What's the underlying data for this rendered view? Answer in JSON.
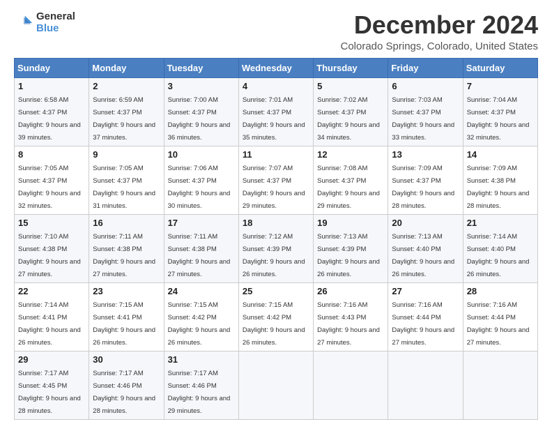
{
  "logo": {
    "general": "General",
    "blue": "Blue"
  },
  "title": "December 2024",
  "subtitle": "Colorado Springs, Colorado, United States",
  "days_header": [
    "Sunday",
    "Monday",
    "Tuesday",
    "Wednesday",
    "Thursday",
    "Friday",
    "Saturday"
  ],
  "weeks": [
    [
      {
        "day": "1",
        "sunrise": "Sunrise: 6:58 AM",
        "sunset": "Sunset: 4:37 PM",
        "daylight": "Daylight: 9 hours and 39 minutes."
      },
      {
        "day": "2",
        "sunrise": "Sunrise: 6:59 AM",
        "sunset": "Sunset: 4:37 PM",
        "daylight": "Daylight: 9 hours and 37 minutes."
      },
      {
        "day": "3",
        "sunrise": "Sunrise: 7:00 AM",
        "sunset": "Sunset: 4:37 PM",
        "daylight": "Daylight: 9 hours and 36 minutes."
      },
      {
        "day": "4",
        "sunrise": "Sunrise: 7:01 AM",
        "sunset": "Sunset: 4:37 PM",
        "daylight": "Daylight: 9 hours and 35 minutes."
      },
      {
        "day": "5",
        "sunrise": "Sunrise: 7:02 AM",
        "sunset": "Sunset: 4:37 PM",
        "daylight": "Daylight: 9 hours and 34 minutes."
      },
      {
        "day": "6",
        "sunrise": "Sunrise: 7:03 AM",
        "sunset": "Sunset: 4:37 PM",
        "daylight": "Daylight: 9 hours and 33 minutes."
      },
      {
        "day": "7",
        "sunrise": "Sunrise: 7:04 AM",
        "sunset": "Sunset: 4:37 PM",
        "daylight": "Daylight: 9 hours and 32 minutes."
      }
    ],
    [
      {
        "day": "8",
        "sunrise": "Sunrise: 7:05 AM",
        "sunset": "Sunset: 4:37 PM",
        "daylight": "Daylight: 9 hours and 32 minutes."
      },
      {
        "day": "9",
        "sunrise": "Sunrise: 7:05 AM",
        "sunset": "Sunset: 4:37 PM",
        "daylight": "Daylight: 9 hours and 31 minutes."
      },
      {
        "day": "10",
        "sunrise": "Sunrise: 7:06 AM",
        "sunset": "Sunset: 4:37 PM",
        "daylight": "Daylight: 9 hours and 30 minutes."
      },
      {
        "day": "11",
        "sunrise": "Sunrise: 7:07 AM",
        "sunset": "Sunset: 4:37 PM",
        "daylight": "Daylight: 9 hours and 29 minutes."
      },
      {
        "day": "12",
        "sunrise": "Sunrise: 7:08 AM",
        "sunset": "Sunset: 4:37 PM",
        "daylight": "Daylight: 9 hours and 29 minutes."
      },
      {
        "day": "13",
        "sunrise": "Sunrise: 7:09 AM",
        "sunset": "Sunset: 4:37 PM",
        "daylight": "Daylight: 9 hours and 28 minutes."
      },
      {
        "day": "14",
        "sunrise": "Sunrise: 7:09 AM",
        "sunset": "Sunset: 4:38 PM",
        "daylight": "Daylight: 9 hours and 28 minutes."
      }
    ],
    [
      {
        "day": "15",
        "sunrise": "Sunrise: 7:10 AM",
        "sunset": "Sunset: 4:38 PM",
        "daylight": "Daylight: 9 hours and 27 minutes."
      },
      {
        "day": "16",
        "sunrise": "Sunrise: 7:11 AM",
        "sunset": "Sunset: 4:38 PM",
        "daylight": "Daylight: 9 hours and 27 minutes."
      },
      {
        "day": "17",
        "sunrise": "Sunrise: 7:11 AM",
        "sunset": "Sunset: 4:38 PM",
        "daylight": "Daylight: 9 hours and 27 minutes."
      },
      {
        "day": "18",
        "sunrise": "Sunrise: 7:12 AM",
        "sunset": "Sunset: 4:39 PM",
        "daylight": "Daylight: 9 hours and 26 minutes."
      },
      {
        "day": "19",
        "sunrise": "Sunrise: 7:13 AM",
        "sunset": "Sunset: 4:39 PM",
        "daylight": "Daylight: 9 hours and 26 minutes."
      },
      {
        "day": "20",
        "sunrise": "Sunrise: 7:13 AM",
        "sunset": "Sunset: 4:40 PM",
        "daylight": "Daylight: 9 hours and 26 minutes."
      },
      {
        "day": "21",
        "sunrise": "Sunrise: 7:14 AM",
        "sunset": "Sunset: 4:40 PM",
        "daylight": "Daylight: 9 hours and 26 minutes."
      }
    ],
    [
      {
        "day": "22",
        "sunrise": "Sunrise: 7:14 AM",
        "sunset": "Sunset: 4:41 PM",
        "daylight": "Daylight: 9 hours and 26 minutes."
      },
      {
        "day": "23",
        "sunrise": "Sunrise: 7:15 AM",
        "sunset": "Sunset: 4:41 PM",
        "daylight": "Daylight: 9 hours and 26 minutes."
      },
      {
        "day": "24",
        "sunrise": "Sunrise: 7:15 AM",
        "sunset": "Sunset: 4:42 PM",
        "daylight": "Daylight: 9 hours and 26 minutes."
      },
      {
        "day": "25",
        "sunrise": "Sunrise: 7:15 AM",
        "sunset": "Sunset: 4:42 PM",
        "daylight": "Daylight: 9 hours and 26 minutes."
      },
      {
        "day": "26",
        "sunrise": "Sunrise: 7:16 AM",
        "sunset": "Sunset: 4:43 PM",
        "daylight": "Daylight: 9 hours and 27 minutes."
      },
      {
        "day": "27",
        "sunrise": "Sunrise: 7:16 AM",
        "sunset": "Sunset: 4:44 PM",
        "daylight": "Daylight: 9 hours and 27 minutes."
      },
      {
        "day": "28",
        "sunrise": "Sunrise: 7:16 AM",
        "sunset": "Sunset: 4:44 PM",
        "daylight": "Daylight: 9 hours and 27 minutes."
      }
    ],
    [
      {
        "day": "29",
        "sunrise": "Sunrise: 7:17 AM",
        "sunset": "Sunset: 4:45 PM",
        "daylight": "Daylight: 9 hours and 28 minutes."
      },
      {
        "day": "30",
        "sunrise": "Sunrise: 7:17 AM",
        "sunset": "Sunset: 4:46 PM",
        "daylight": "Daylight: 9 hours and 28 minutes."
      },
      {
        "day": "31",
        "sunrise": "Sunrise: 7:17 AM",
        "sunset": "Sunset: 4:46 PM",
        "daylight": "Daylight: 9 hours and 29 minutes."
      },
      null,
      null,
      null,
      null
    ]
  ]
}
